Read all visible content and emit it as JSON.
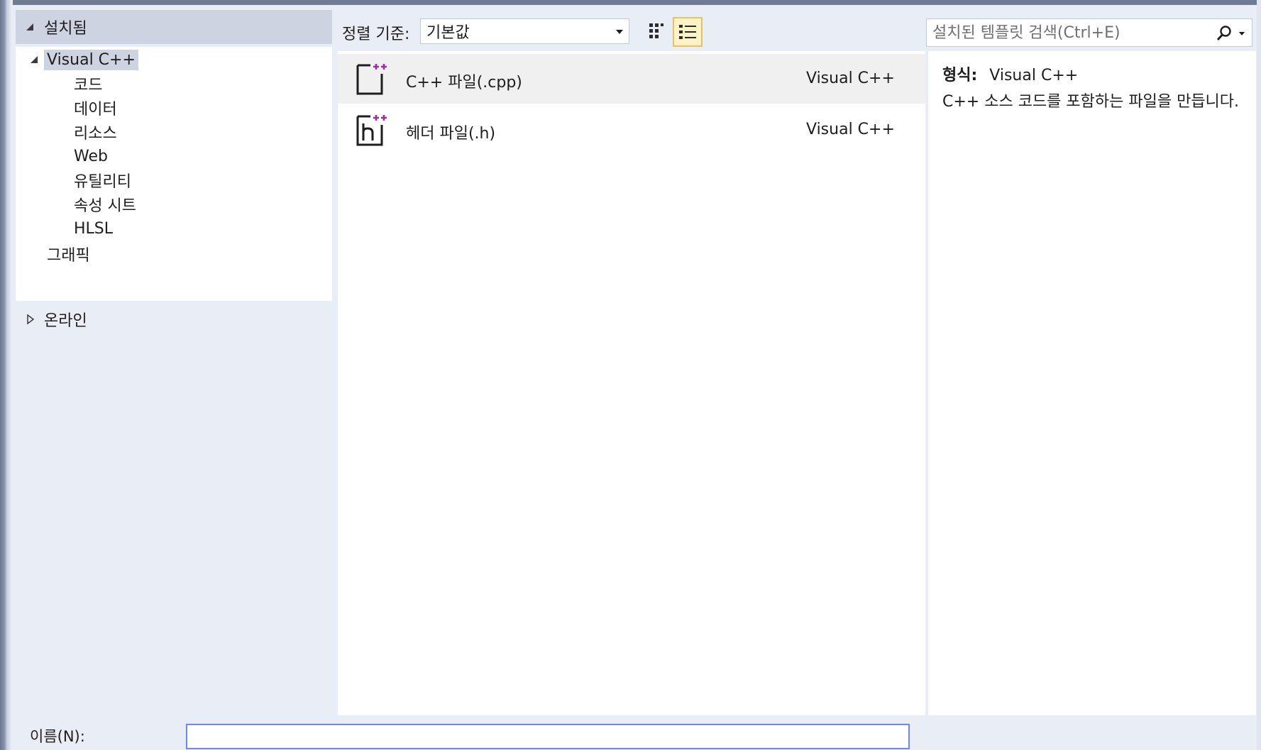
{
  "installed": {
    "header_label": "설치됨",
    "tree": {
      "root_label": "Visual C++",
      "children": [
        "코드",
        "데이터",
        "리소스",
        "Web",
        "유틸리티",
        "속성 시트",
        "HLSL"
      ],
      "sibling_label": "그래픽"
    }
  },
  "online": {
    "label": "온라인"
  },
  "toolbar": {
    "sort_label": "정렬 기준:",
    "sort_value": "기본값",
    "search_placeholder": "설치된 템플릿 검색(Ctrl+E)"
  },
  "templates": [
    {
      "name": "C++ 파일(.cpp)",
      "language": "Visual C++",
      "icon": "cpp-file-icon",
      "selected": true
    },
    {
      "name": "헤더 파일(.h)",
      "language": "Visual C++",
      "icon": "header-file-icon",
      "selected": false
    }
  ],
  "details": {
    "type_label": "형식:",
    "type_value": "Visual C++",
    "description": "C++ 소스 코드를 포함하는 파일을 만듭니다."
  },
  "bottom": {
    "name_label": "이름(N):",
    "name_value": ""
  },
  "colors": {
    "panel_bg": "#e9edf6",
    "header_bg": "#cdd3e0",
    "selected_row": "#f0f0f0",
    "active_view_bg": "#fff3c6",
    "active_view_border": "#e5c365",
    "input_focus_border": "#6f86ef",
    "icon_plus": "#9b2fa0"
  }
}
